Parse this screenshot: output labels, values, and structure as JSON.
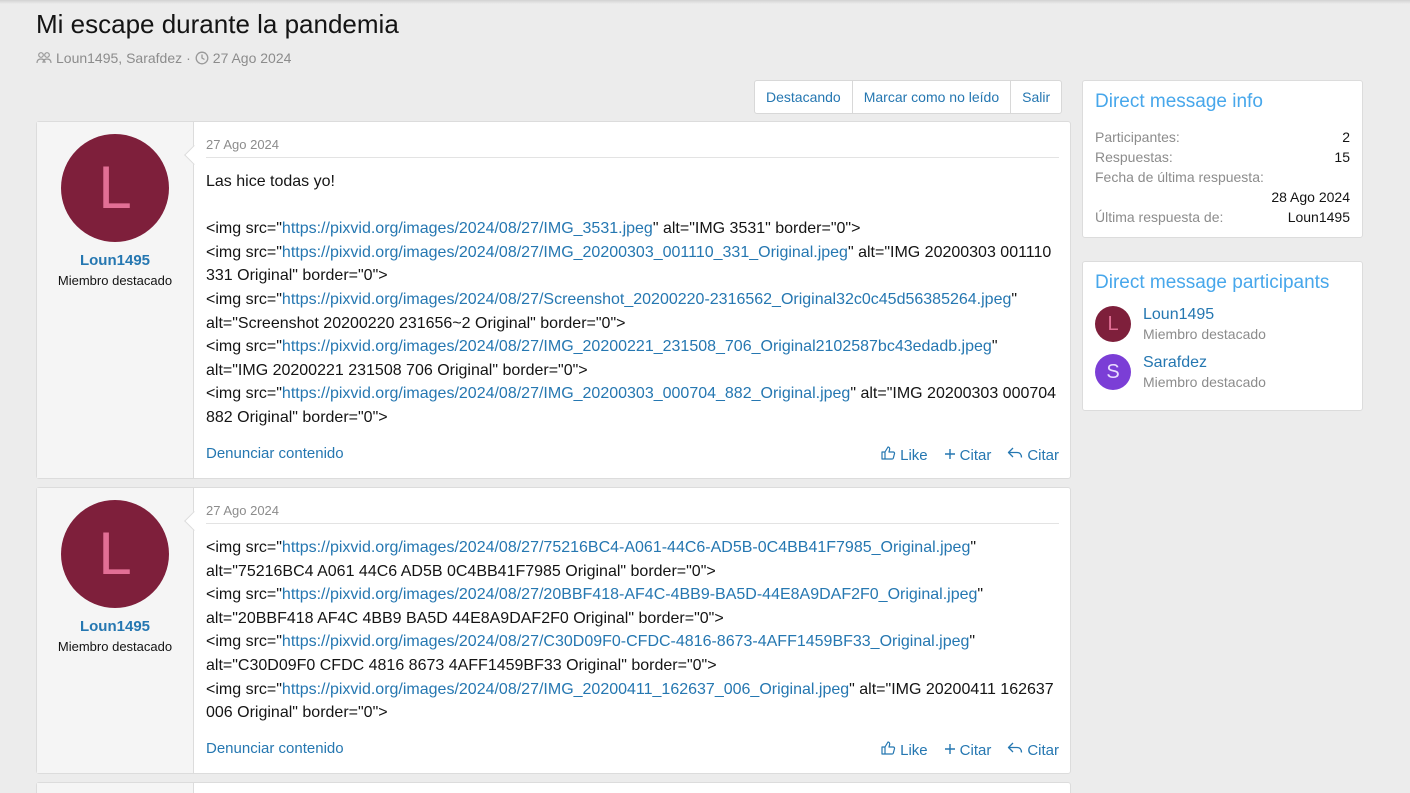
{
  "thread": {
    "title": "Mi escape durante la pandemia",
    "participants_text": "Loun1495, Sarafdez",
    "separator": "·",
    "date": "27 Ago 2024"
  },
  "actions": [
    "Destacando",
    "Marcar como no leído",
    "Salir"
  ],
  "messages": [
    {
      "avatar_letter": "L",
      "username": "Loun1495",
      "user_title": "Miembro destacado",
      "date": "27 Ago 2024",
      "first_line": "Las hice todas yo!",
      "report": "Denunciar contenido",
      "like": "Like",
      "quote": "Citar",
      "reply": "Citar",
      "parts": [
        [
          "<img src=\"",
          "https://pixvid.org/images/2024/08/27/IMG_3531.jpeg",
          "\" alt=\"IMG 3531\" border=\"0\">"
        ],
        [
          "<img src=\"",
          "https://pixvid.org/images/2024/08/27/IMG_20200303_001110_331_Original.jpeg",
          "\" alt=\"IMG 20200303 001110 331 Original\" border=\"0\">"
        ],
        [
          "<img src=\"",
          "https://pixvid.org/images/2024/08/27/Screenshot_20200220-2316562_Original32c0c45d56385264.jpeg",
          "\" alt=\"Screenshot 20200220 231656~2 Original\" border=\"0\">"
        ],
        [
          "<img src=\"",
          "https://pixvid.org/images/2024/08/27/IMG_20200221_231508_706_Original2102587bc43edadb.jpeg",
          "\" alt=\"IMG 20200221 231508 706 Original\" border=\"0\">"
        ],
        [
          "<img src=\"",
          "https://pixvid.org/images/2024/08/27/IMG_20200303_000704_882_Original.jpeg",
          "\" alt=\"IMG 20200303 000704 882 Original\" border=\"0\">"
        ]
      ]
    },
    {
      "avatar_letter": "L",
      "username": "Loun1495",
      "user_title": "Miembro destacado",
      "date": "27 Ago 2024",
      "report": "Denunciar contenido",
      "like": "Like",
      "quote": "Citar",
      "reply": "Citar",
      "parts": [
        [
          "<img src=\"",
          "https://pixvid.org/images/2024/08/27/75216BC4-A061-44C6-AD5B-0C4BB41F7985_Original.jpeg",
          "\" alt=\"75216BC4 A061 44C6 AD5B 0C4BB41F7985 Original\" border=\"0\">"
        ],
        [
          "<img src=\"",
          "https://pixvid.org/images/2024/08/27/20BBF418-AF4C-4BB9-BA5D-44E8A9DAF2F0_Original.jpeg",
          "\" alt=\"20BBF418 AF4C 4BB9 BA5D 44E8A9DAF2F0 Original\" border=\"0\">"
        ],
        [
          "<img src=\"",
          "https://pixvid.org/images/2024/08/27/C30D09F0-CFDC-4816-8673-4AFF1459BF33_Original.jpeg",
          "\" alt=\"C30D09F0 CFDC 4816 8673 4AFF1459BF33 Original\" border=\"0\">"
        ],
        [
          "<img src=\"",
          "https://pixvid.org/images/2024/08/27/IMG_20200411_162637_006_Original.jpeg",
          "\" alt=\"IMG 20200411 162637 006 Original\" border=\"0\">"
        ]
      ]
    }
  ],
  "info": {
    "title": "Direct message info",
    "participants_label": "Participantes:",
    "participants_value": "2",
    "replies_label": "Respuestas:",
    "replies_value": "15",
    "last_date_label": "Fecha de última respuesta:",
    "last_date_value": "28 Ago 2024",
    "last_by_label": "Última respuesta de:",
    "last_by_value": "Loun1495"
  },
  "participants_block": {
    "title": "Direct message participants",
    "people": [
      {
        "letter": "L",
        "name": "Loun1495",
        "title": "Miembro destacado",
        "bg": "#7e1f3b",
        "fg": "#e26f95"
      },
      {
        "letter": "S",
        "name": "Sarafdez",
        "title": "Miembro destacado",
        "bg": "#7b3ed6",
        "fg": "#e9dcff"
      }
    ]
  },
  "colors": {
    "link": "#2577b1",
    "block_title": "#47a7eb"
  }
}
